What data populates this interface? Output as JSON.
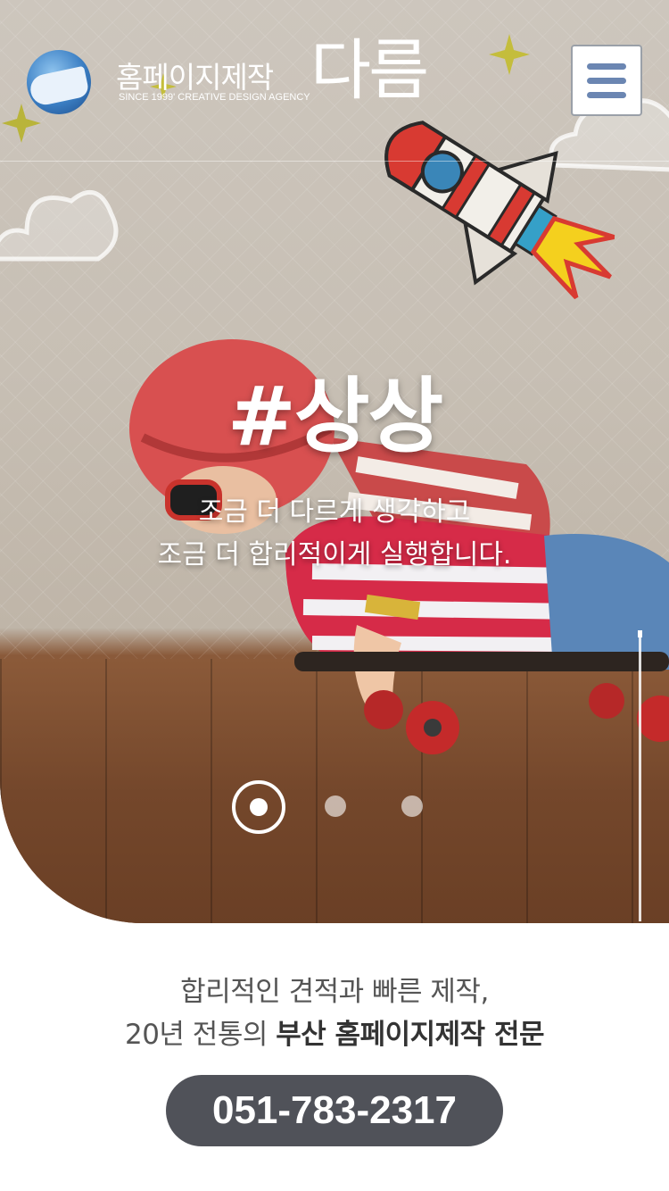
{
  "header": {
    "brand_main": "홈페이지제작",
    "brand_sub": "SINCE 1999' CREATIVE DESIGN AGENCY",
    "brand_name": "다름"
  },
  "hero": {
    "title": "#상상",
    "line1": "조금 더 다르게 생각하고",
    "line2": "조금 더 합리적이게 실행합니다.",
    "slides_total": 3,
    "active_slide": 1
  },
  "intro": {
    "line1": "합리적인 견적과 빠른 제작,",
    "line2_prefix": "20년 전통의 ",
    "line2_bold": "부산 홈페이지제작 전문"
  },
  "contact": {
    "phone": "051-783-2317"
  },
  "colors": {
    "menu_lines": "#6b86b2",
    "phone_button_bg": "#505259",
    "text_gray": "#555555"
  },
  "icons": {
    "menu": "hamburger-icon",
    "logo": "whale-logo-icon"
  }
}
